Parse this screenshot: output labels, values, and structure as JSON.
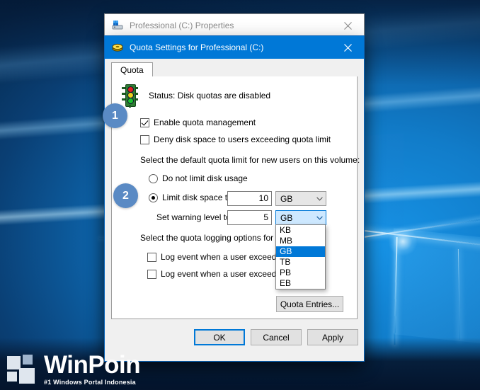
{
  "wallpaper": {
    "name": "windows-10-hero"
  },
  "back_window": {
    "title": "Professional (C:) Properties",
    "icon": "drive-icon",
    "close_icon": "close-icon",
    "buttons": {
      "ok": "OK",
      "cancel": "Cancel",
      "apply": "Apply"
    }
  },
  "front_window": {
    "title": "Quota Settings for Professional (C:)",
    "icon": "quota-disk-icon",
    "close_icon": "close-icon",
    "tabs": [
      {
        "label": "Quota",
        "selected": true
      }
    ],
    "status": {
      "icon": "traffic-light-icon",
      "text": "Status:  Disk quotas are disabled"
    },
    "checkboxes": [
      {
        "label": "Enable quota management",
        "checked": true
      },
      {
        "label": "Deny disk space to users exceeding quota limit",
        "checked": false
      }
    ],
    "default_limit_heading": "Select the default quota limit for new users on this volume:",
    "radios": [
      {
        "label": "Do not limit disk usage",
        "selected": false
      },
      {
        "label": "Limit disk space to",
        "selected": true
      }
    ],
    "warning_label": "Set warning level to",
    "limit_value": "10",
    "warning_value": "5",
    "limit_unit": "GB",
    "warning_unit": "GB",
    "unit_options": [
      "KB",
      "MB",
      "GB",
      "TB",
      "PB",
      "EB"
    ],
    "unit_selected": "GB",
    "logging_heading": "Select the quota logging options for this vo",
    "log_checkboxes": [
      {
        "label": "Log event when a user exceeds their",
        "checked": false
      },
      {
        "label": "Log event when a user exceeds their",
        "checked": false
      }
    ],
    "quota_entries_label": "Quota Entries...",
    "buttons": {
      "ok": "OK",
      "cancel": "Cancel",
      "apply": "Apply"
    }
  },
  "badges": [
    {
      "number": "1"
    },
    {
      "number": "2"
    }
  ],
  "watermark": {
    "title": "WinPoin",
    "subtitle": "#1 Windows Portal Indonesia"
  },
  "colors": {
    "accent": "#0078d7",
    "badge": "#5a8ac4",
    "highlight": "#0078d7",
    "combo_active": "#cde8ff"
  }
}
